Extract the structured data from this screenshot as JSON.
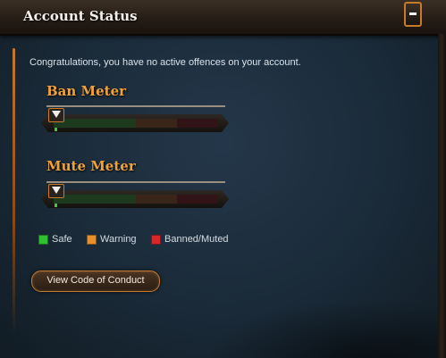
{
  "header": {
    "title": "Account Status"
  },
  "message": "Congratulations, you have no active offences on your account.",
  "meters": [
    {
      "title": "Ban Meter",
      "level": 0
    },
    {
      "title": "Mute Meter",
      "level": 0
    }
  ],
  "legend": [
    {
      "label": "Safe",
      "color": "#2fbf2f"
    },
    {
      "label": "Warning",
      "color": "#e8902c"
    },
    {
      "label": "Banned/Muted",
      "color": "#d9262a"
    }
  ],
  "conduct_button": "View Code of Conduct",
  "icons": {
    "collapse": "minus-icon",
    "meter_indicator": "triangle-down-icon"
  }
}
